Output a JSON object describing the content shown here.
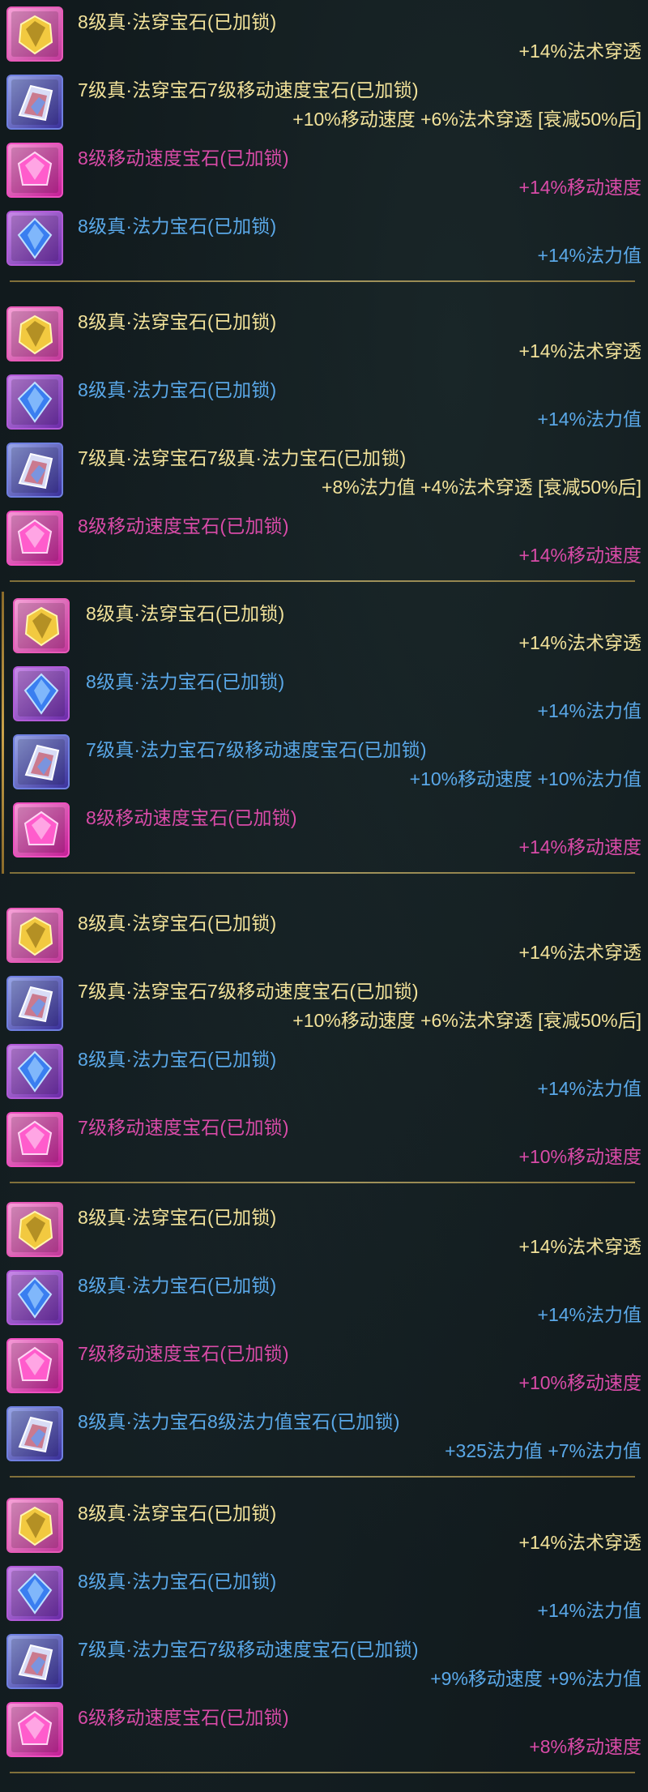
{
  "colors": {
    "yellow": "#f2e29a",
    "blue": "#5aa8e8",
    "pink": "#d94ba8",
    "divider": "#b8a060"
  },
  "panels": [
    {
      "rows": [
        {
          "icon": "magic-pierce-gem-icon",
          "kind": "pierce",
          "name": "8级真·法穿宝石(已加锁)",
          "effect": "+14%法术穿透",
          "color": "yellow"
        },
        {
          "icon": "combo-gem-icon",
          "kind": "combo",
          "name": "7级真·法穿宝石7级移动速度宝石(已加锁)",
          "effect": "+10%移动速度 +6%法术穿透 [衰减50%后]",
          "color": "yellow"
        },
        {
          "icon": "move-speed-gem-icon",
          "kind": "speed",
          "name": "8级移动速度宝石(已加锁)",
          "effect": "+14%移动速度",
          "color": "pink"
        },
        {
          "icon": "mana-gem-icon",
          "kind": "mana",
          "name": "8级真·法力宝石(已加锁)",
          "effect": "+14%法力值",
          "color": "blue"
        }
      ]
    },
    {
      "rows": [
        {
          "icon": "magic-pierce-gem-icon",
          "kind": "pierce",
          "name": "8级真·法穿宝石(已加锁)",
          "effect": "+14%法术穿透",
          "color": "yellow"
        },
        {
          "icon": "mana-gem-icon",
          "kind": "mana",
          "name": "8级真·法力宝石(已加锁)",
          "effect": "+14%法力值",
          "color": "blue"
        },
        {
          "icon": "combo-gem-icon",
          "kind": "combo",
          "name": "7级真·法穿宝石7级真·法力宝石(已加锁)",
          "effect": "+8%法力值 +4%法术穿透 [衰减50%后]",
          "color": "yellow"
        },
        {
          "icon": "move-speed-gem-icon",
          "kind": "speed",
          "name": "8级移动速度宝石(已加锁)",
          "effect": "+14%移动速度",
          "color": "pink"
        }
      ]
    },
    {
      "shifted": true,
      "rows": [
        {
          "icon": "magic-pierce-gem-icon",
          "kind": "pierce",
          "name": "8级真·法穿宝石(已加锁)",
          "effect": "+14%法术穿透",
          "color": "yellow"
        },
        {
          "icon": "mana-gem-icon",
          "kind": "mana",
          "name": "8级真·法力宝石(已加锁)",
          "effect": "+14%法力值",
          "color": "blue"
        },
        {
          "icon": "combo-gem-icon",
          "kind": "combo",
          "name": "7级真·法力宝石7级移动速度宝石(已加锁)",
          "effect": "+10%移动速度 +10%法力值",
          "color": "blue"
        },
        {
          "icon": "move-speed-gem-icon",
          "kind": "speed",
          "name": "8级移动速度宝石(已加锁)",
          "effect": "+14%移动速度",
          "color": "pink"
        }
      ]
    },
    {
      "rows": [
        {
          "icon": "magic-pierce-gem-icon",
          "kind": "pierce",
          "name": "8级真·法穿宝石(已加锁)",
          "effect": "+14%法术穿透",
          "color": "yellow"
        },
        {
          "icon": "combo-gem-icon",
          "kind": "combo",
          "name": "7级真·法穿宝石7级移动速度宝石(已加锁)",
          "effect": "+10%移动速度 +6%法术穿透 [衰减50%后]",
          "color": "yellow"
        },
        {
          "icon": "mana-gem-icon",
          "kind": "mana",
          "name": "8级真·法力宝石(已加锁)",
          "effect": "+14%法力值",
          "color": "blue"
        },
        {
          "icon": "move-speed-gem-icon",
          "kind": "speed",
          "name": "7级移动速度宝石(已加锁)",
          "effect": "+10%移动速度",
          "color": "pink"
        }
      ]
    },
    {
      "rows": [
        {
          "icon": "magic-pierce-gem-icon",
          "kind": "pierce",
          "name": "8级真·法穿宝石(已加锁)",
          "effect": "+14%法术穿透",
          "color": "yellow"
        },
        {
          "icon": "mana-gem-icon",
          "kind": "mana",
          "name": "8级真·法力宝石(已加锁)",
          "effect": "+14%法力值",
          "color": "blue"
        },
        {
          "icon": "move-speed-gem-icon",
          "kind": "speed",
          "name": "7级移动速度宝石(已加锁)",
          "effect": "+10%移动速度",
          "color": "pink"
        },
        {
          "icon": "mana-combo-gem-icon",
          "kind": "combo",
          "name": "8级真·法力宝石8级法力值宝石(已加锁)",
          "effect": "+325法力值 +7%法力值",
          "color": "blue"
        }
      ]
    },
    {
      "rows": [
        {
          "icon": "magic-pierce-gem-icon",
          "kind": "pierce",
          "name": "8级真·法穿宝石(已加锁)",
          "effect": "+14%法术穿透",
          "color": "yellow"
        },
        {
          "icon": "mana-gem-icon",
          "kind": "mana",
          "name": "8级真·法力宝石(已加锁)",
          "effect": "+14%法力值",
          "color": "blue"
        },
        {
          "icon": "combo-gem-icon",
          "kind": "combo",
          "name": "7级真·法力宝石7级移动速度宝石(已加锁)",
          "effect": "+9%移动速度 +9%法力值",
          "color": "blue"
        },
        {
          "icon": "move-speed-gem-icon",
          "kind": "speed",
          "name": "6级移动速度宝石(已加锁)",
          "effect": "+8%移动速度",
          "color": "pink"
        }
      ]
    }
  ]
}
